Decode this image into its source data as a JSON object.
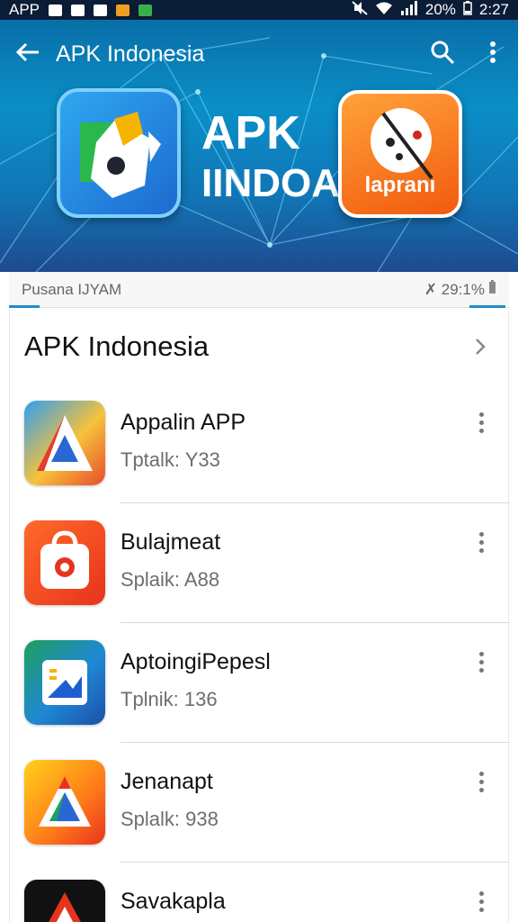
{
  "status_bar": {
    "carrier_label": "APP",
    "battery_percent": "20%",
    "time": "2:27"
  },
  "header": {
    "title": "APK Indonesia",
    "back_icon": "arrow-left-icon",
    "search_icon": "search-icon",
    "more_icon": "more-vertical-icon"
  },
  "hero": {
    "brand_line1": "APK",
    "brand_line2": "IINDOA",
    "right_icon_text": "lapranı"
  },
  "substrip": {
    "left_text": "Pusana IJYAM",
    "right_text": "✗ 29:1%"
  },
  "section": {
    "title": "APK Indonesia",
    "chevron_icon": "chevron-right-icon"
  },
  "apps": [
    {
      "name": "Appalin APP",
      "subtitle": "Tptalk: Y33"
    },
    {
      "name": "Bulajmeat",
      "subtitle": "Splaik: A88"
    },
    {
      "name": "AptoingiPepesl",
      "subtitle": "Tplnik: 136"
    },
    {
      "name": "Jenanapt",
      "subtitle": "Splalk: 938"
    },
    {
      "name": "Savakapla",
      "subtitle": ""
    }
  ],
  "colors": {
    "accent": "#1a8fc7",
    "hero_top": "#0a6ea8",
    "hero_bottom": "#1e4a8e"
  }
}
